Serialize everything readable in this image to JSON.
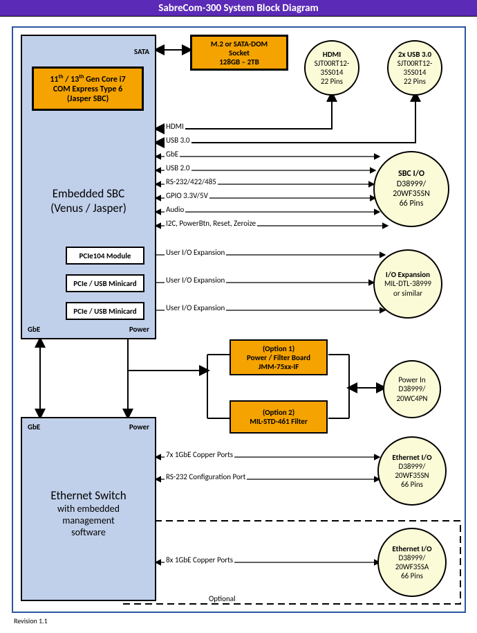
{
  "title": "SabreCom-300 System Block Diagram",
  "revision": "Revision 1.1",
  "sbc": {
    "title1": "Embedded SBC",
    "title2": "(Venus /  Jasper)",
    "com": {
      "l1": "11",
      "sup1": "th",
      "mid1": " / 13",
      "sup2": "th",
      "rest": " Gen Core i7",
      "l2": "COM Express Type 6",
      "l3": "(Jasper SBC)"
    },
    "sata": "SATA",
    "gbe": "GbE",
    "power": "Power",
    "modules": {
      "a": "PCIe104 Module",
      "b": "PCIe / USB Minicard",
      "c": "PCIe / USB Minicard"
    }
  },
  "eth": {
    "gbe": "GbE",
    "power": "Power",
    "l1": "Ethernet Switch",
    "l2": "with embedded",
    "l3": "management",
    "l4": "software"
  },
  "storage": {
    "l1": "M.2 or SATA-DOM",
    "l2": "Socket",
    "l3": "128GB – 2TB"
  },
  "circles": {
    "hdmi": {
      "t": "HDMI",
      "l1": "SJT00RT12-",
      "l2": "35S014",
      "l3": "22 Pins"
    },
    "usb": {
      "t": "2x USB 3.0",
      "l1": "SJT00RT12-",
      "l2": "35S014",
      "l3": "22 Pins"
    },
    "sbcio": {
      "t": "SBC I/O",
      "l1": "D38999/",
      "l2": "20WF35SN",
      "l3": "66 Pins"
    },
    "ioexp": {
      "t": "I/O Expansion",
      "l1": "MIL-DTL-38999",
      "l2": "or similar"
    },
    "pwr": {
      "t": "Power In",
      "l1": "D38999/",
      "l2": "20WC4PN"
    },
    "eth1": {
      "t": "Ethernet I/O",
      "l1": "D38999/",
      "l2": "20WF35SN",
      "l3": "66 Pins"
    },
    "eth2": {
      "t": "Ethernet I/O",
      "l1": "D38999/",
      "l2": "20WF35SA",
      "l3": "66 Pins"
    }
  },
  "options": {
    "a": {
      "l1": "(Option 1)",
      "l2": "Power / Filter Board",
      "l3": "JMM-75xx-IF"
    },
    "b": {
      "l1": "(Option 2)",
      "l2": "MIL-STD-461 Filter"
    }
  },
  "buses": {
    "hdmi": "HDMI",
    "usb30": "USB 3.0",
    "gbe": "GbE",
    "usb20": "USB 2.0",
    "rs": "RS-232/422/485",
    "gpio": "GPIO 3.3V/5V",
    "audio": "Audio",
    "i2c": "I2C, PowerBtn, Reset, Zeroize",
    "uio": "User I/O Expansion",
    "eth7": "7x 1GbE Copper Ports",
    "cfg": "RS-232 Configuration Port",
    "eth8": "8x 1GbE Copper Ports",
    "optional": "Optional"
  }
}
